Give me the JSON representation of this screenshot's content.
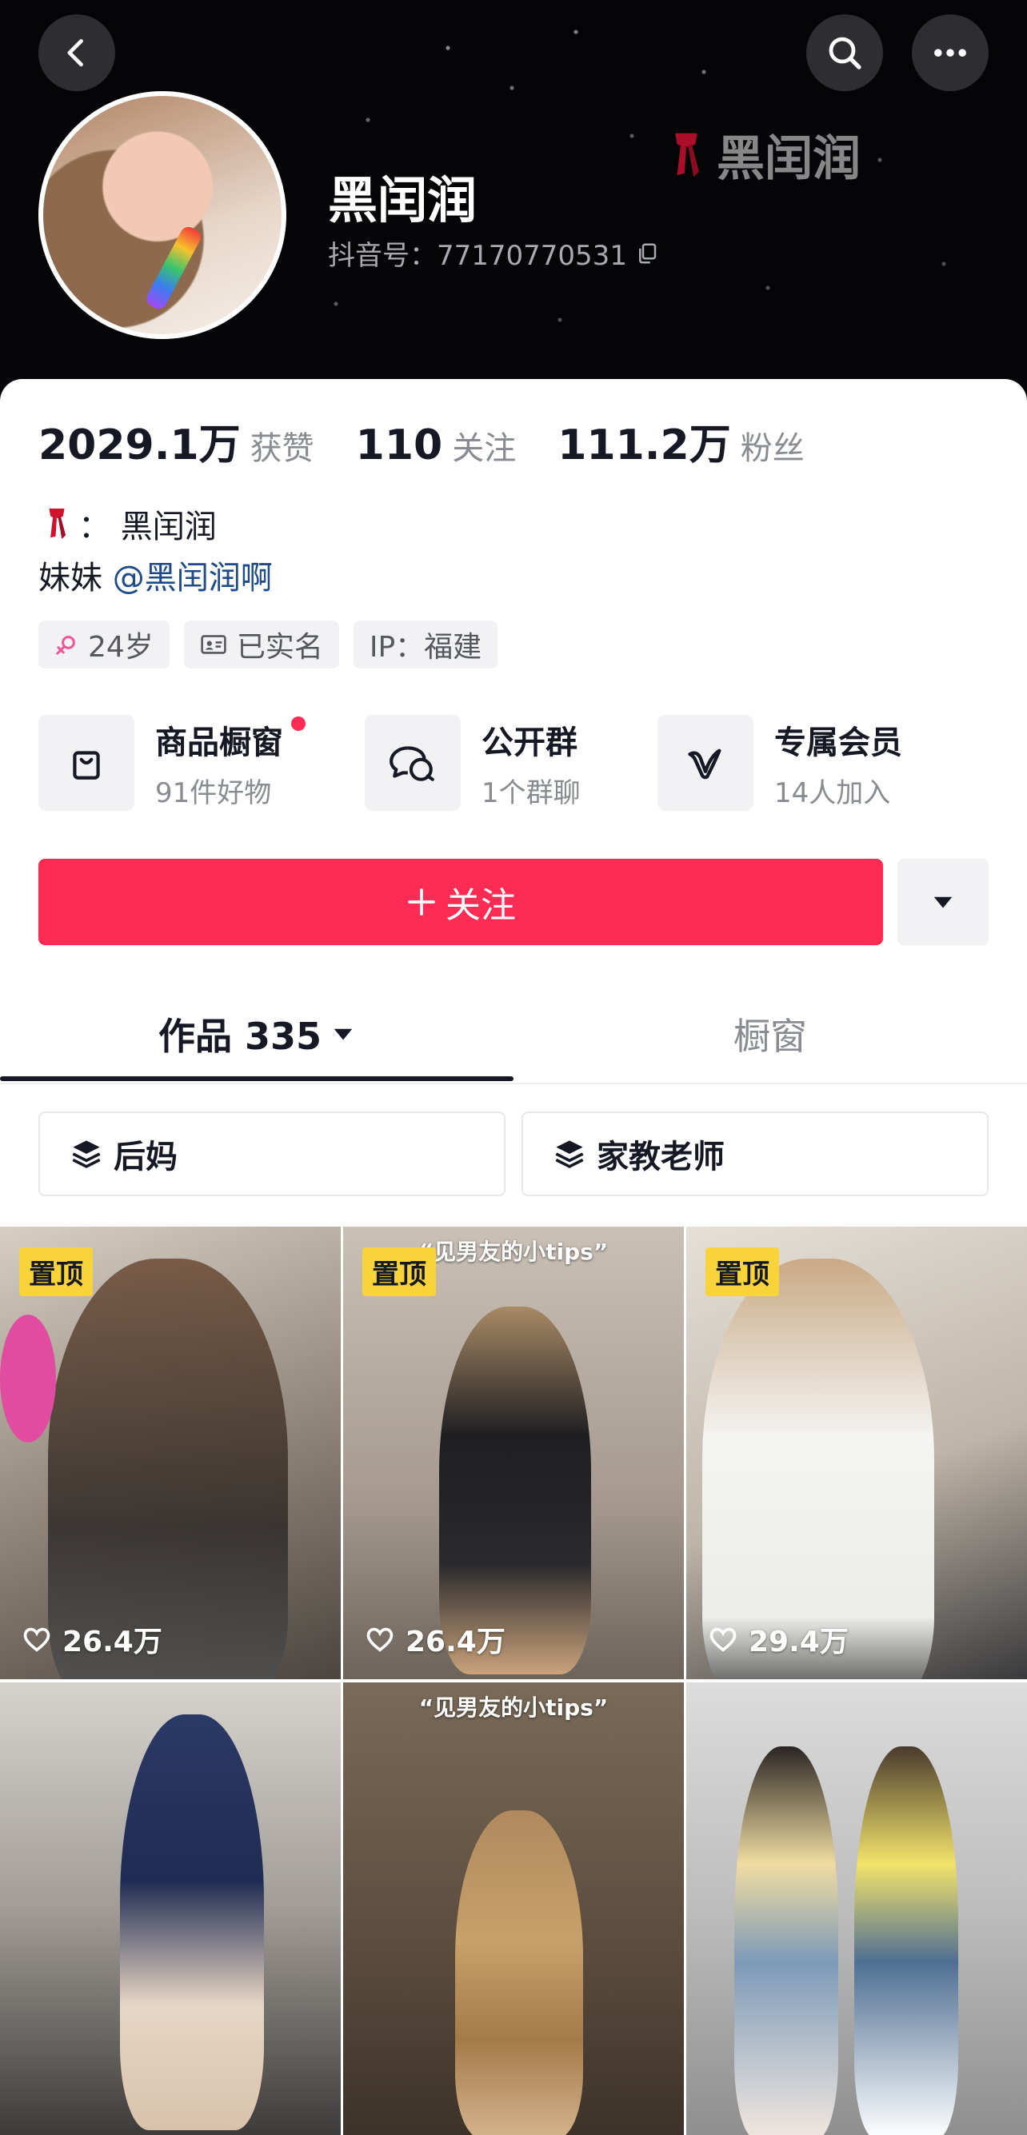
{
  "header": {
    "name": "黑闰润",
    "douyin_id": "抖音号：77170770531",
    "watermark": "黑闰润"
  },
  "stats": [
    {
      "value": "2029.1万",
      "label": "获赞"
    },
    {
      "value": "110",
      "label": "关注"
    },
    {
      "value": "111.2万",
      "label": "粉丝"
    }
  ],
  "bio": {
    "line1": "：  黑闰润",
    "line2_prefix": "妹妹",
    "line2_mention": "@黑闰润啊"
  },
  "tags": {
    "age": "24岁",
    "verified": "已实名",
    "ip": "IP：福建"
  },
  "services": [
    {
      "title": "商品橱窗",
      "sub": "91件好物"
    },
    {
      "title": "公开群",
      "sub": "1个群聊"
    },
    {
      "title": "专属会员",
      "sub": "14人加入"
    }
  ],
  "follow_label": "关注",
  "tabs": {
    "works": "作品 335",
    "showcase": "橱窗"
  },
  "collections": [
    "后妈",
    "家教老师"
  ],
  "videos": [
    {
      "pinned": "置顶",
      "likes": "26.4万",
      "caption": ""
    },
    {
      "pinned": "置顶",
      "likes": "26.4万",
      "caption": "“见男友的小tips”"
    },
    {
      "pinned": "置顶",
      "likes": "29.4万",
      "caption": ""
    },
    {
      "pinned": "",
      "likes": "",
      "caption": ""
    },
    {
      "pinned": "",
      "likes": "",
      "caption": "“见男友的小tips”"
    },
    {
      "pinned": "",
      "likes": "",
      "caption": ""
    }
  ],
  "colors": {
    "accent": "#fe2c55",
    "pin_badge": "#f9d33a",
    "mention": "#1c4a8a",
    "header_bg": "#050507"
  }
}
